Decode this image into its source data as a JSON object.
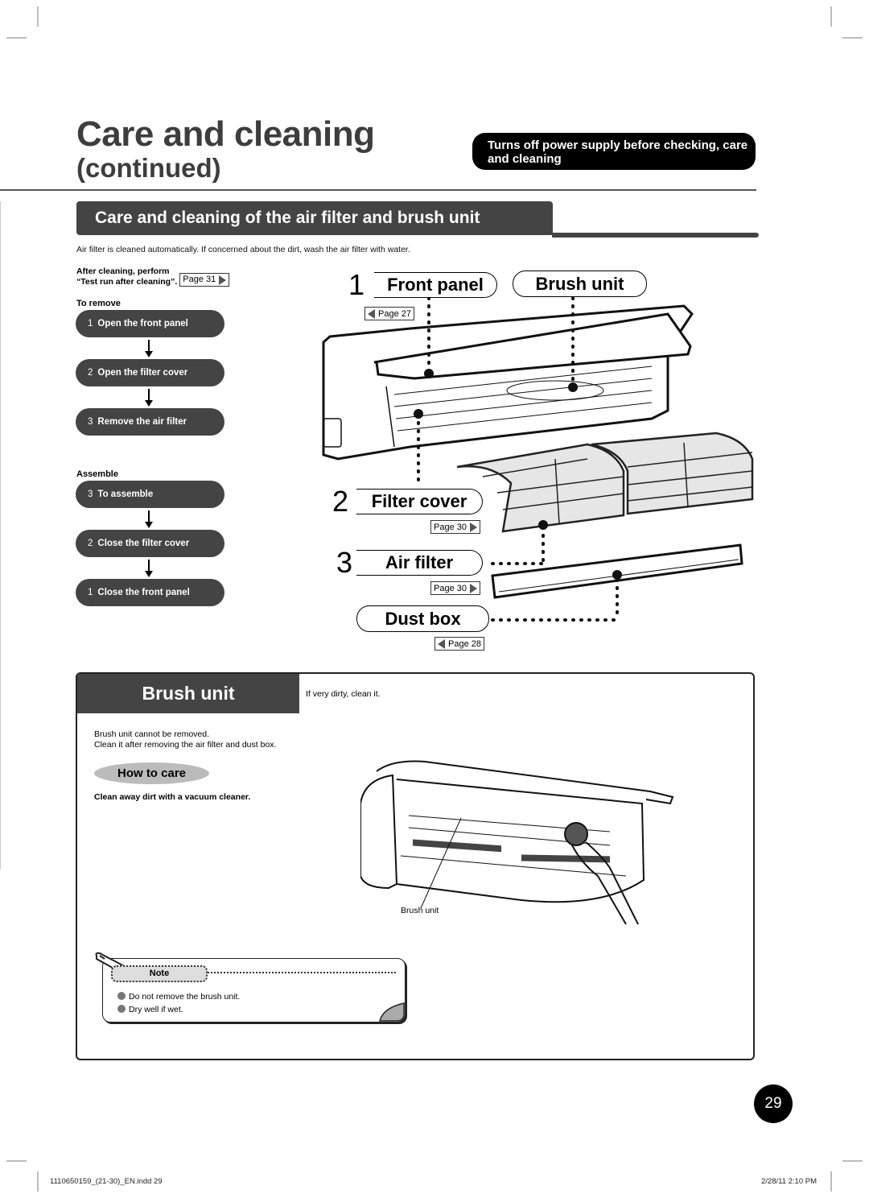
{
  "header": {
    "title": "Care and cleaning",
    "subtitle": "(continued)",
    "warning": "Turns off power supply before checking, care and cleaning"
  },
  "section": {
    "title": "Care and cleaning of the air filter and brush unit",
    "intro": "Air filter is cleaned automatically. If concerned about the dirt, wash the air filter with water.",
    "after_cleaning_line1": "After cleaning, perform",
    "after_cleaning_line2": "“Test run after cleaning”.",
    "after_cleaning_page": "Page 31"
  },
  "remove": {
    "label": "To remove",
    "steps": [
      {
        "num": "1",
        "text": "Open the front panel"
      },
      {
        "num": "2",
        "text": "Open the filter cover"
      },
      {
        "num": "3",
        "text": "Remove the air filter"
      }
    ]
  },
  "assemble": {
    "label": "Assemble",
    "steps": [
      {
        "num": "3",
        "text": "To assemble"
      },
      {
        "num": "2",
        "text": "Close the filter cover"
      },
      {
        "num": "1",
        "text": "Close the front panel"
      }
    ]
  },
  "diagram": {
    "callouts": [
      {
        "num": "1",
        "label": "Front panel",
        "page": "Page 27",
        "page_dir": "left"
      },
      {
        "num": "",
        "label": "Brush unit",
        "page": "",
        "page_dir": ""
      },
      {
        "num": "2",
        "label": "Filter cover",
        "page": "Page 30",
        "page_dir": "right"
      },
      {
        "num": "3",
        "label": "Air filter",
        "page": "Page 30",
        "page_dir": "right"
      },
      {
        "num": "",
        "label": "Dust box",
        "page": "Page 28",
        "page_dir": "left"
      }
    ]
  },
  "brush_unit": {
    "title": "Brush unit",
    "condition": "If very dirty, clean it.",
    "desc_line1": "Brush unit cannot be removed.",
    "desc_line2": "Clean it after removing the air filter and dust box.",
    "how_to_care": "How to care",
    "instruction": "Clean away dirt with a vacuum cleaner.",
    "figure_label": "Brush unit",
    "note": {
      "label": "Note",
      "items": [
        "Do not remove the brush unit.",
        "Dry well if wet."
      ]
    }
  },
  "footer": {
    "page_number": "29",
    "file": "1110650159_(21-30)_EN.indd   29",
    "datetime": "2/28/11   2:10 PM"
  }
}
